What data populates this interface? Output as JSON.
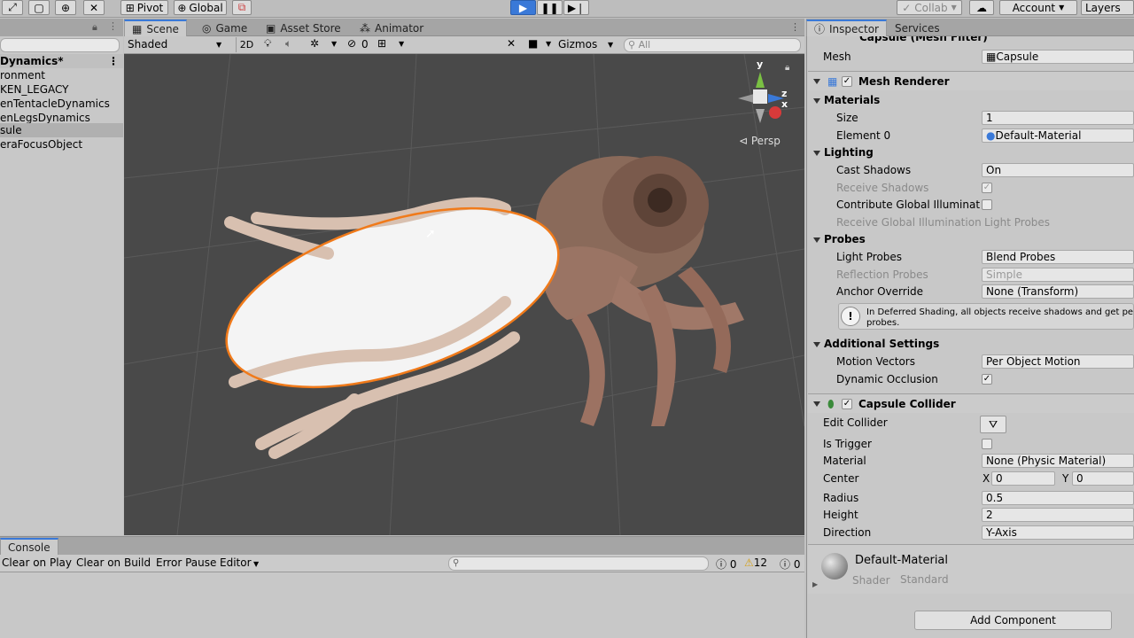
{
  "toolbar": {
    "pivot_label": "Pivot",
    "global_label": "Global",
    "collab_label": "Collab",
    "account_label": "Account",
    "layers_label": "Layers"
  },
  "hierarchy": {
    "scene_title": "Dynamics*",
    "items": [
      "ronment",
      "KEN_LEGACY",
      "enTentacleDynamics",
      "enLegsDynamics",
      "sule",
      "eraFocusObject"
    ],
    "selected_index": 4
  },
  "scene_view": {
    "tabs": [
      "Scene",
      "Game",
      "Asset Store",
      "Animator"
    ],
    "shading": "Shaded",
    "mode_2d": "2D",
    "hidden_count": "0",
    "gizmos_label": "Gizmos",
    "search_placeholder": "All",
    "persp_label": "Persp",
    "axis_y": "y",
    "axis_x": "x",
    "axis_z": "z"
  },
  "console": {
    "tab": "Console",
    "clear_on_play": "Clear on Play",
    "clear_on_build": "Clear on Build",
    "error_pause": "Error Pause",
    "editor": "Editor",
    "info_count": "0",
    "warn_count": "12",
    "error_count": "0"
  },
  "inspector": {
    "tabs": [
      "Inspector",
      "Services"
    ],
    "mesh_filter_header": "Capsule (Mesh Filter)",
    "mesh_label": "Mesh",
    "mesh_value": "Capsule",
    "mesh_renderer": "Mesh Renderer",
    "materials_header": "Materials",
    "size_label": "Size",
    "size_value": "1",
    "element0_label": "Element 0",
    "element0_value": "Default-Material",
    "lighting_header": "Lighting",
    "cast_shadows_label": "Cast Shadows",
    "cast_shadows_value": "On",
    "receive_shadows_label": "Receive Shadows",
    "contribute_gi_label": "Contribute Global Illuminatio",
    "receive_gi_label": "Receive Global Illumination",
    "receive_gi_value": "Light Probes",
    "probes_header": "Probes",
    "light_probes_label": "Light Probes",
    "light_probes_value": "Blend Probes",
    "reflection_probes_label": "Reflection Probes",
    "reflection_probes_value": "Simple",
    "anchor_override_label": "Anchor Override",
    "anchor_override_value": "None (Transform)",
    "info_text_1": "In Deferred Shading, all objects receive shadows and get per",
    "info_text_2": "probes.",
    "additional_header": "Additional Settings",
    "motion_vectors_label": "Motion Vectors",
    "motion_vectors_value": "Per Object Motion",
    "dynamic_occlusion_label": "Dynamic Occlusion",
    "capsule_collider": "Capsule Collider",
    "edit_collider_label": "Edit Collider",
    "is_trigger_label": "Is Trigger",
    "material_label": "Material",
    "material_value": "None (Physic Material)",
    "center_label": "Center",
    "center_x_label": "X",
    "center_x": "0",
    "center_y_label": "Y",
    "center_y": "0",
    "radius_label": "Radius",
    "radius_value": "0.5",
    "height_label": "Height",
    "height_value": "2",
    "direction_label": "Direction",
    "direction_value": "Y-Axis",
    "material_asset_name": "Default-Material",
    "shader_label": "Shader",
    "shader_value": "Standard",
    "add_component": "Add Component"
  },
  "colors": {
    "accent": "#3a79d8",
    "selection_outline": "#f07a1a",
    "scene_bg": "#494949"
  }
}
